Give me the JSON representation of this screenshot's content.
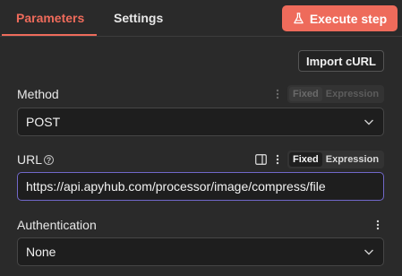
{
  "tabs": [
    {
      "label": "Parameters",
      "active": true
    },
    {
      "label": "Settings",
      "active": false
    }
  ],
  "execute_button": {
    "label": "Execute step",
    "icon": "flask-icon"
  },
  "import_curl": {
    "label": "Import cURL"
  },
  "method": {
    "label": "Method",
    "value": "POST",
    "mode_toggle": {
      "options": [
        "Fixed",
        "Expression"
      ],
      "selected": "Fixed"
    }
  },
  "url": {
    "label": "URL",
    "help_icon": "?",
    "value": "https://api.apyhub.com/processor/image/compress/file",
    "mode_toggle": {
      "options": [
        "Fixed",
        "Expression"
      ],
      "selected": "Fixed"
    }
  },
  "authentication": {
    "label": "Authentication",
    "value": "None"
  },
  "colors": {
    "accent": "#ee6b5b",
    "focus_border": "#7168c9",
    "background": "#2a2a2a",
    "field_bg": "#1e1e1e"
  }
}
